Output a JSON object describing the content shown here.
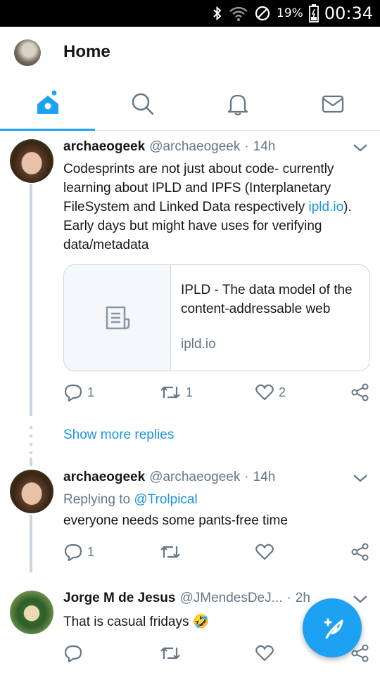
{
  "status_bar": {
    "battery_percent": "19%",
    "time": "00:34",
    "icons": [
      "bluetooth-icon",
      "wifi-icon",
      "no-signal-icon",
      "battery-icon"
    ]
  },
  "header": {
    "title": "Home"
  },
  "tabs": [
    {
      "name": "home",
      "icon": "home-icon",
      "active": true
    },
    {
      "name": "search",
      "icon": "search-icon",
      "active": false
    },
    {
      "name": "notifications",
      "icon": "bell-icon",
      "active": false
    },
    {
      "name": "messages",
      "icon": "mail-icon",
      "active": false
    }
  ],
  "tweets": [
    {
      "name": "archaeogeek",
      "handle": "@archaeogeek",
      "dot": "·",
      "time": "14h",
      "text_before_link": "Codesprints are not just about code- currently learning about IPLD and IPFS (Interplanetary FileSystem and Linked Data respectively ",
      "link": "ipld.io",
      "text_after_link": "). Early days but might have uses for verifying data/metadata",
      "card": {
        "title": "IPLD - The data model of the content-addressable web",
        "domain": "ipld.io"
      },
      "replies": "1",
      "retweets": "1",
      "likes": "2"
    },
    {
      "name": "archaeogeek",
      "handle": "@archaeogeek",
      "dot": "·",
      "time": "14h",
      "replying_prefix": "Replying to ",
      "replying_to": "@Trolpical",
      "text": "everyone needs some pants-free time",
      "replies": "1",
      "retweets": "",
      "likes": ""
    },
    {
      "name": "Jorge M de Jesus",
      "handle": "@JMendesDeJ...",
      "dot": "·",
      "time": "2h",
      "text": "That is casual fridays",
      "emoji": "🤣",
      "replies": "",
      "retweets": "",
      "likes": ""
    }
  ],
  "show_more_replies": "Show more replies",
  "colors": {
    "accent": "#1da1f2",
    "link": "#1b95e0",
    "muted": "#657786",
    "text": "#14171a"
  }
}
